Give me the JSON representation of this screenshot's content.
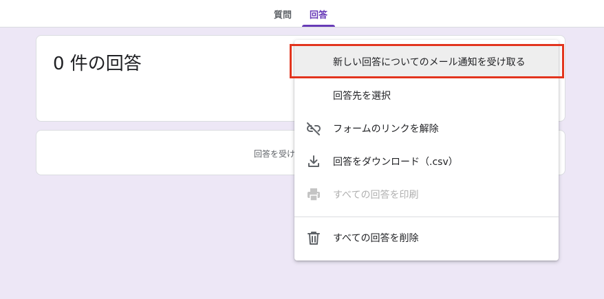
{
  "tabs": {
    "questions": "質問",
    "responses": "回答"
  },
  "summary": {
    "title": "0 件の回答"
  },
  "status": {
    "text": "回答を受け"
  },
  "menu": {
    "items": [
      {
        "label": "新しい回答についてのメール通知を受け取る",
        "icon": "",
        "highlighted": true
      },
      {
        "label": "回答先を選択",
        "icon": ""
      },
      {
        "label": "フォームのリンクを解除",
        "icon": "link-off-icon"
      },
      {
        "label": "回答をダウンロード（.csv）",
        "icon": "download-icon"
      },
      {
        "label": "すべての回答を印刷",
        "icon": "print-icon",
        "disabled": true
      },
      {
        "label": "すべての回答を削除",
        "icon": "trash-icon"
      }
    ]
  },
  "colors": {
    "accent": "#673ab7",
    "background": "#ede7f6",
    "highlight_box": "#e2341d"
  }
}
